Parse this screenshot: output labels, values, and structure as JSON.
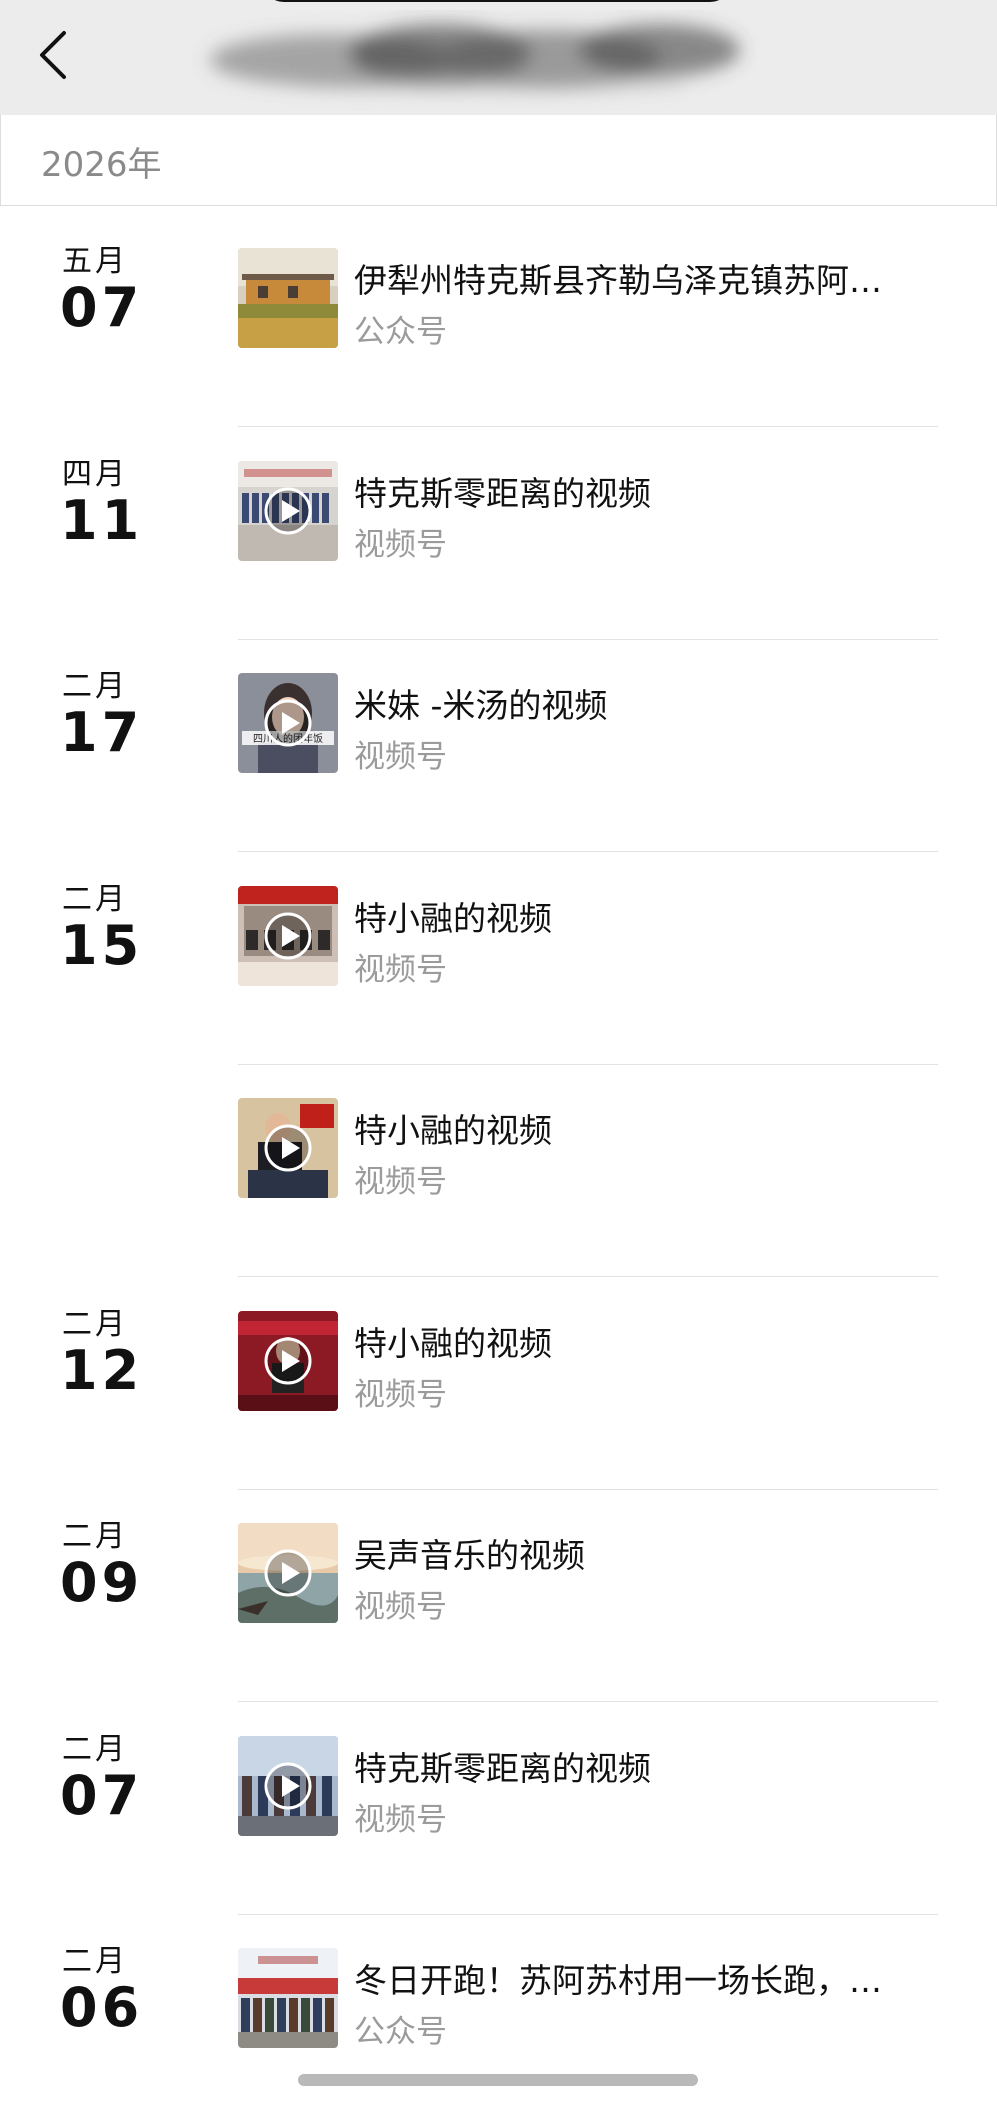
{
  "header": {
    "back_icon": "chevron-left-icon",
    "title_obscured": true
  },
  "year_label": "2026年",
  "entries": [
    {
      "month": "五月",
      "day": "07",
      "title": "伊犁州特克斯县齐勒乌泽克镇苏阿…",
      "source": "公众号",
      "thumb": "building-photo",
      "play": false
    },
    {
      "month": "四月",
      "day": "11",
      "title": "特克斯零距离的视频",
      "source": "视频号",
      "thumb": "crowd-banner",
      "play": true
    },
    {
      "month": "二月",
      "day": "17",
      "title": "米妹 -米汤的视频",
      "source": "视频号",
      "thumb": "woman-portrait",
      "play": true,
      "thumb_caption": "四川人的团年饭"
    },
    {
      "month": "二月",
      "day": "15",
      "title": "特小融的视频",
      "source": "视频号",
      "thumb": "meeting-red-banner",
      "play": true
    },
    {
      "month": "",
      "day": "",
      "title": "特小融的视频",
      "source": "视频号",
      "thumb": "man-flag",
      "play": true
    },
    {
      "month": "二月",
      "day": "12",
      "title": "特小融的视频",
      "source": "视频号",
      "thumb": "red-stage",
      "play": true
    },
    {
      "month": "二月",
      "day": "09",
      "title": "吴声音乐的视频",
      "source": "视频号",
      "thumb": "sunset-lake",
      "play": true
    },
    {
      "month": "二月",
      "day": "07",
      "title": "特克斯零距离的视频",
      "source": "视频号",
      "thumb": "street-crowd",
      "play": true
    },
    {
      "month": "二月",
      "day": "06",
      "title": "冬日开跑！苏阿苏村用一场长跑，…",
      "source": "公众号",
      "thumb": "runners-group",
      "play": false
    }
  ],
  "colors": {
    "header_bg": "#ececec",
    "source_text": "#9b9b9b",
    "divider": "#e3e3e3"
  }
}
